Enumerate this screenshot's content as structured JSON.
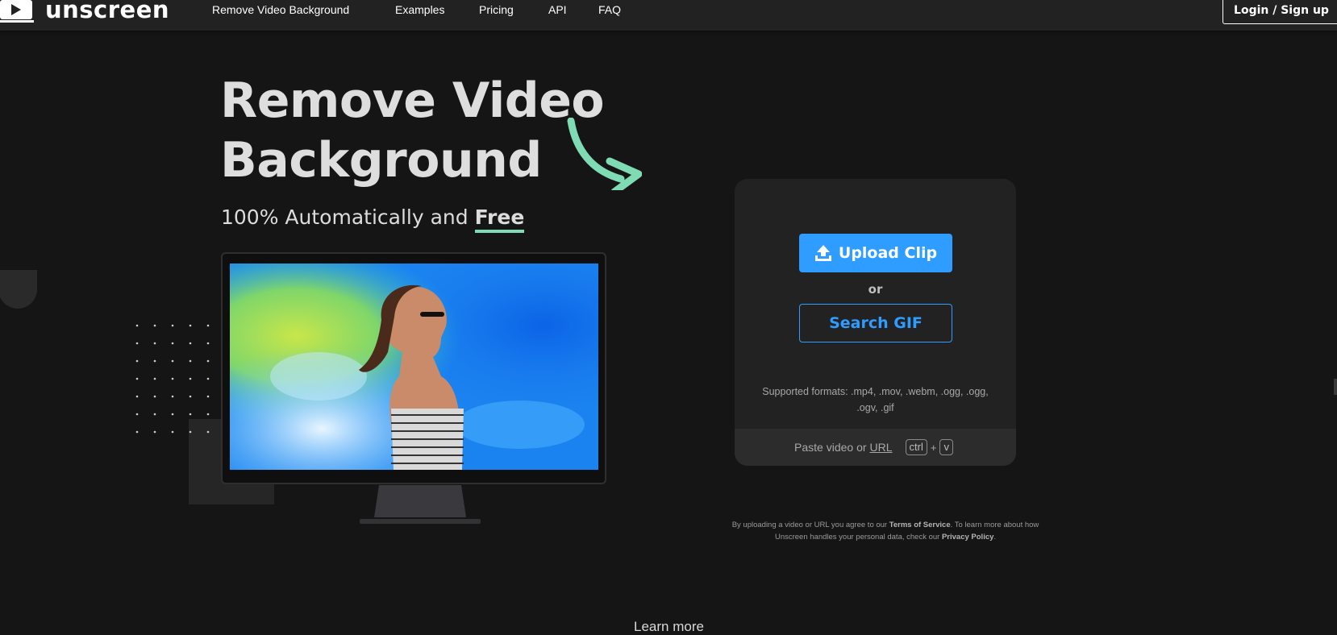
{
  "nav": {
    "logo_text": "unscreen",
    "links": [
      "Remove Video Background",
      "Examples",
      "Pricing",
      "API",
      "FAQ"
    ],
    "login_label": "Login / Sign up"
  },
  "hero": {
    "title_line1": "Remove Video",
    "title_line2": "Background",
    "subtitle_prefix": "100% Automatically and",
    "subtitle_emphasis": "Free"
  },
  "upload": {
    "upload_label": "Upload Clip",
    "or_label": "or",
    "gif_label": "Search GIF",
    "formats_text": "Supported formats: .mp4, .mov, .webm, .ogg, .ogg, .ogv, .gif",
    "paste_prefix": "Paste video or",
    "paste_url": "URL",
    "key_ctrl": "ctrl",
    "key_plus": "+",
    "key_v": "v"
  },
  "legal": {
    "part1": "By uploading a video or URL you agree to our",
    "tos": "Terms of Service",
    "part2": ". To learn more about how Unscreen handles your personal data, check our",
    "privacy": "Privacy Policy",
    "part3": "."
  },
  "footer": {
    "learn_more": "Learn more"
  },
  "colors": {
    "accent_blue": "#2f9cff",
    "accent_green": "#7fdbb3",
    "background": "#151515",
    "nav": "#222222",
    "card": "#222222"
  },
  "icons": [
    "unscreen-logo-icon",
    "upload-icon",
    "curved-arrow-icon"
  ]
}
